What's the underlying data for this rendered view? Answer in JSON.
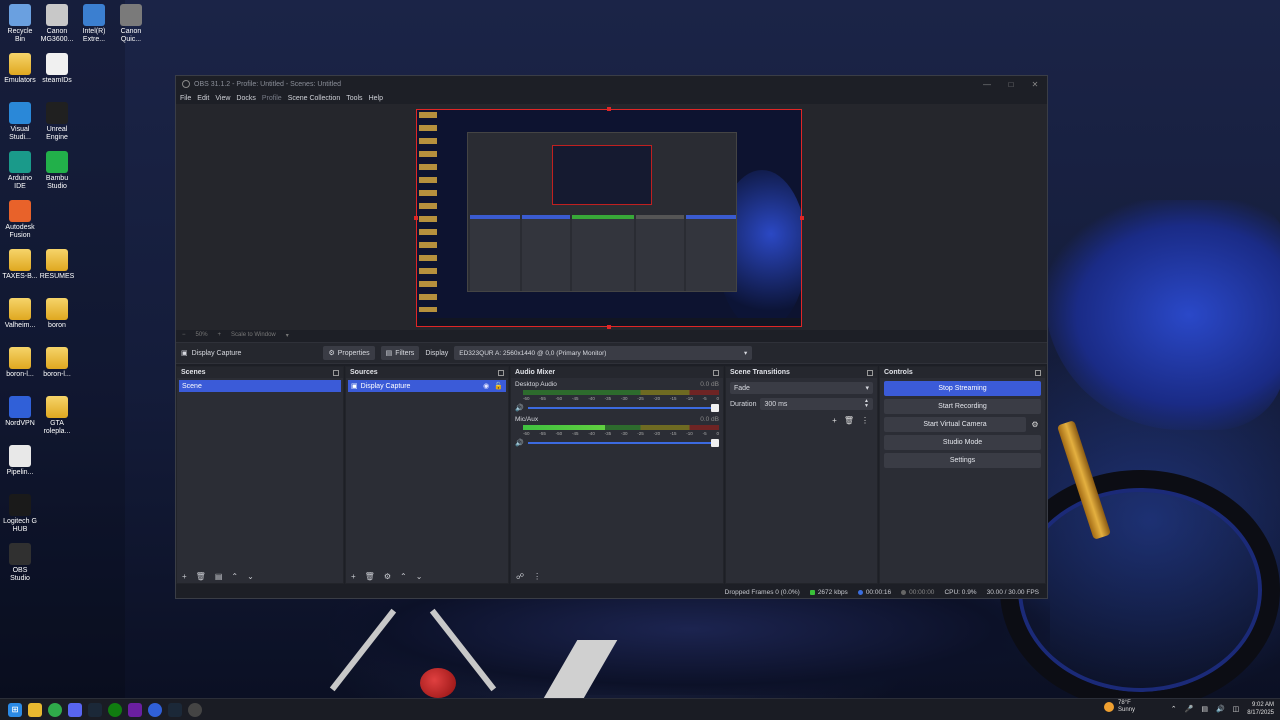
{
  "desktop_icons": [
    {
      "label": "Recycle Bin",
      "line1": "Recycle",
      "line2": "Bin",
      "icon": "recycle-bin-icon",
      "color": "#6aa0e0"
    },
    {
      "label": "Canon MG3600...",
      "line1": "Canon",
      "line2": "MG3600...",
      "icon": "printer-icon",
      "color": "#c8c8c8"
    },
    {
      "label": "Intel(R) Extre...",
      "line1": "Intel(R)",
      "line2": "Extre...",
      "icon": "intel-icon",
      "color": "#3b7fd0"
    },
    {
      "label": "Canon Quic...",
      "line1": "Canon",
      "line2": "Quic...",
      "icon": "canon-quick-icon",
      "color": "#7a7a7a"
    },
    {
      "label": "Emulators",
      "line1": "Emulators",
      "line2": "",
      "icon": "folder-icon",
      "color": "#e8b830"
    },
    {
      "label": "steamIDs",
      "line1": "steamIDs",
      "line2": "",
      "icon": "text-file-icon",
      "color": "#f0f0f0"
    },
    {
      "label": "Visual Studi...",
      "line1": "Visual",
      "line2": "Studi...",
      "icon": "vscode-icon",
      "color": "#2a88d8"
    },
    {
      "label": "Unreal Engine",
      "line1": "Unreal",
      "line2": "Engine",
      "icon": "unreal-icon",
      "color": "#202020"
    },
    {
      "label": "Arduino IDE",
      "line1": "Arduino",
      "line2": "IDE",
      "icon": "arduino-icon",
      "color": "#1a9a8a"
    },
    {
      "label": "Bambu Studio",
      "line1": "Bambu",
      "line2": "Studio",
      "icon": "bambu-icon",
      "color": "#22b04a"
    },
    {
      "label": "Autodesk Fusion",
      "line1": "Autodesk",
      "line2": "Fusion",
      "icon": "fusion-icon",
      "color": "#e8622a"
    },
    {
      "label": "TAXES-B...",
      "line1": "TAXES-B...",
      "line2": "",
      "icon": "folder-icon",
      "color": "#e8b830"
    },
    {
      "label": "RESUMES",
      "line1": "RESUMES",
      "line2": "",
      "icon": "folder-icon",
      "color": "#e8b830"
    },
    {
      "label": "Valheim...",
      "line1": "Valheim...",
      "line2": "",
      "icon": "folder-icon",
      "color": "#e8b830"
    },
    {
      "label": "boron",
      "line1": "boron",
      "line2": "",
      "icon": "folder-icon",
      "color": "#e8b830"
    },
    {
      "label": "boron-l...",
      "line1": "boron-l...",
      "line2": "",
      "icon": "folder-icon",
      "color": "#e8b830"
    },
    {
      "label": "boron-l...",
      "line1": "boron-l...",
      "line2": "",
      "icon": "folder-icon",
      "color": "#e8b830"
    },
    {
      "label": "NordVPN",
      "line1": "NordVPN",
      "line2": "",
      "icon": "nordvpn-icon",
      "color": "#3060d8"
    },
    {
      "label": "GTA roleplа...",
      "line1": "GTA",
      "line2": "rolepla...",
      "icon": "folder-icon",
      "color": "#e8b830"
    },
    {
      "label": "Pipelin...",
      "line1": "Pipelin...",
      "line2": "",
      "icon": "chrome-icon",
      "color": "#e8e8e8"
    },
    {
      "label": "Logitech G HUB",
      "line1": "Logitech G",
      "line2": "HUB",
      "icon": "logitech-icon",
      "color": "#1a1a1a"
    },
    {
      "label": "OBS Studio",
      "line1": "OBS",
      "line2": "Studio",
      "icon": "obs-icon",
      "color": "#303030"
    }
  ],
  "obs": {
    "title": "OBS 31.1.2 - Profile: Untitled - Scenes: Untitled",
    "menu": [
      "File",
      "Edit",
      "View",
      "Docks",
      "Profile",
      "Scene Collection",
      "Tools",
      "Help"
    ],
    "zoom_label": "50%",
    "scale_label": "Scale to Window",
    "source_toolbar": {
      "source_name": "Display Capture",
      "properties": "Properties",
      "filters": "Filters",
      "display_label": "Display",
      "display_value": "ED323QUR A: 2560x1440 @ 0,0 (Primary Monitor)"
    },
    "scenes": {
      "title": "Scenes",
      "items": [
        "Scene"
      ]
    },
    "sources": {
      "title": "Sources",
      "items": [
        "Display Capture"
      ]
    },
    "mixer": {
      "title": "Audio Mixer",
      "ticks": [
        "-60",
        "-55",
        "-50",
        "-45",
        "-40",
        "-35",
        "-30",
        "-25",
        "-20",
        "-15",
        "-10",
        "-5",
        "0"
      ],
      "channels": [
        {
          "name": "Desktop Audio",
          "db": "0.0 dB",
          "level": 0.0
        },
        {
          "name": "Mic/Aux",
          "db": "0.0 dB",
          "level": 0.42
        }
      ]
    },
    "transitions": {
      "title": "Scene Transitions",
      "selected": "Fade",
      "duration_label": "Duration",
      "duration_value": "300 ms"
    },
    "controls": {
      "title": "Controls",
      "stop_streaming": "Stop Streaming",
      "start_recording": "Start Recording",
      "start_virtual_camera": "Start Virtual Camera",
      "studio_mode": "Studio Mode",
      "settings": "Settings"
    },
    "status": {
      "dropped": "Dropped Frames 0 (0.0%)",
      "bitrate": "2672 kbps",
      "stream_time": "00:00:16",
      "rec_time": "00:00:00",
      "cpu": "CPU: 0.9%",
      "fps": "30.00 / 30.00 FPS"
    }
  },
  "taskbar": {
    "weather_temp": "78°F",
    "weather_cond": "Sunny",
    "time": "9:02 AM",
    "date": "8/17/2025"
  },
  "colors": {
    "accent": "#3b5bd8",
    "preview_border": "#e02626"
  }
}
